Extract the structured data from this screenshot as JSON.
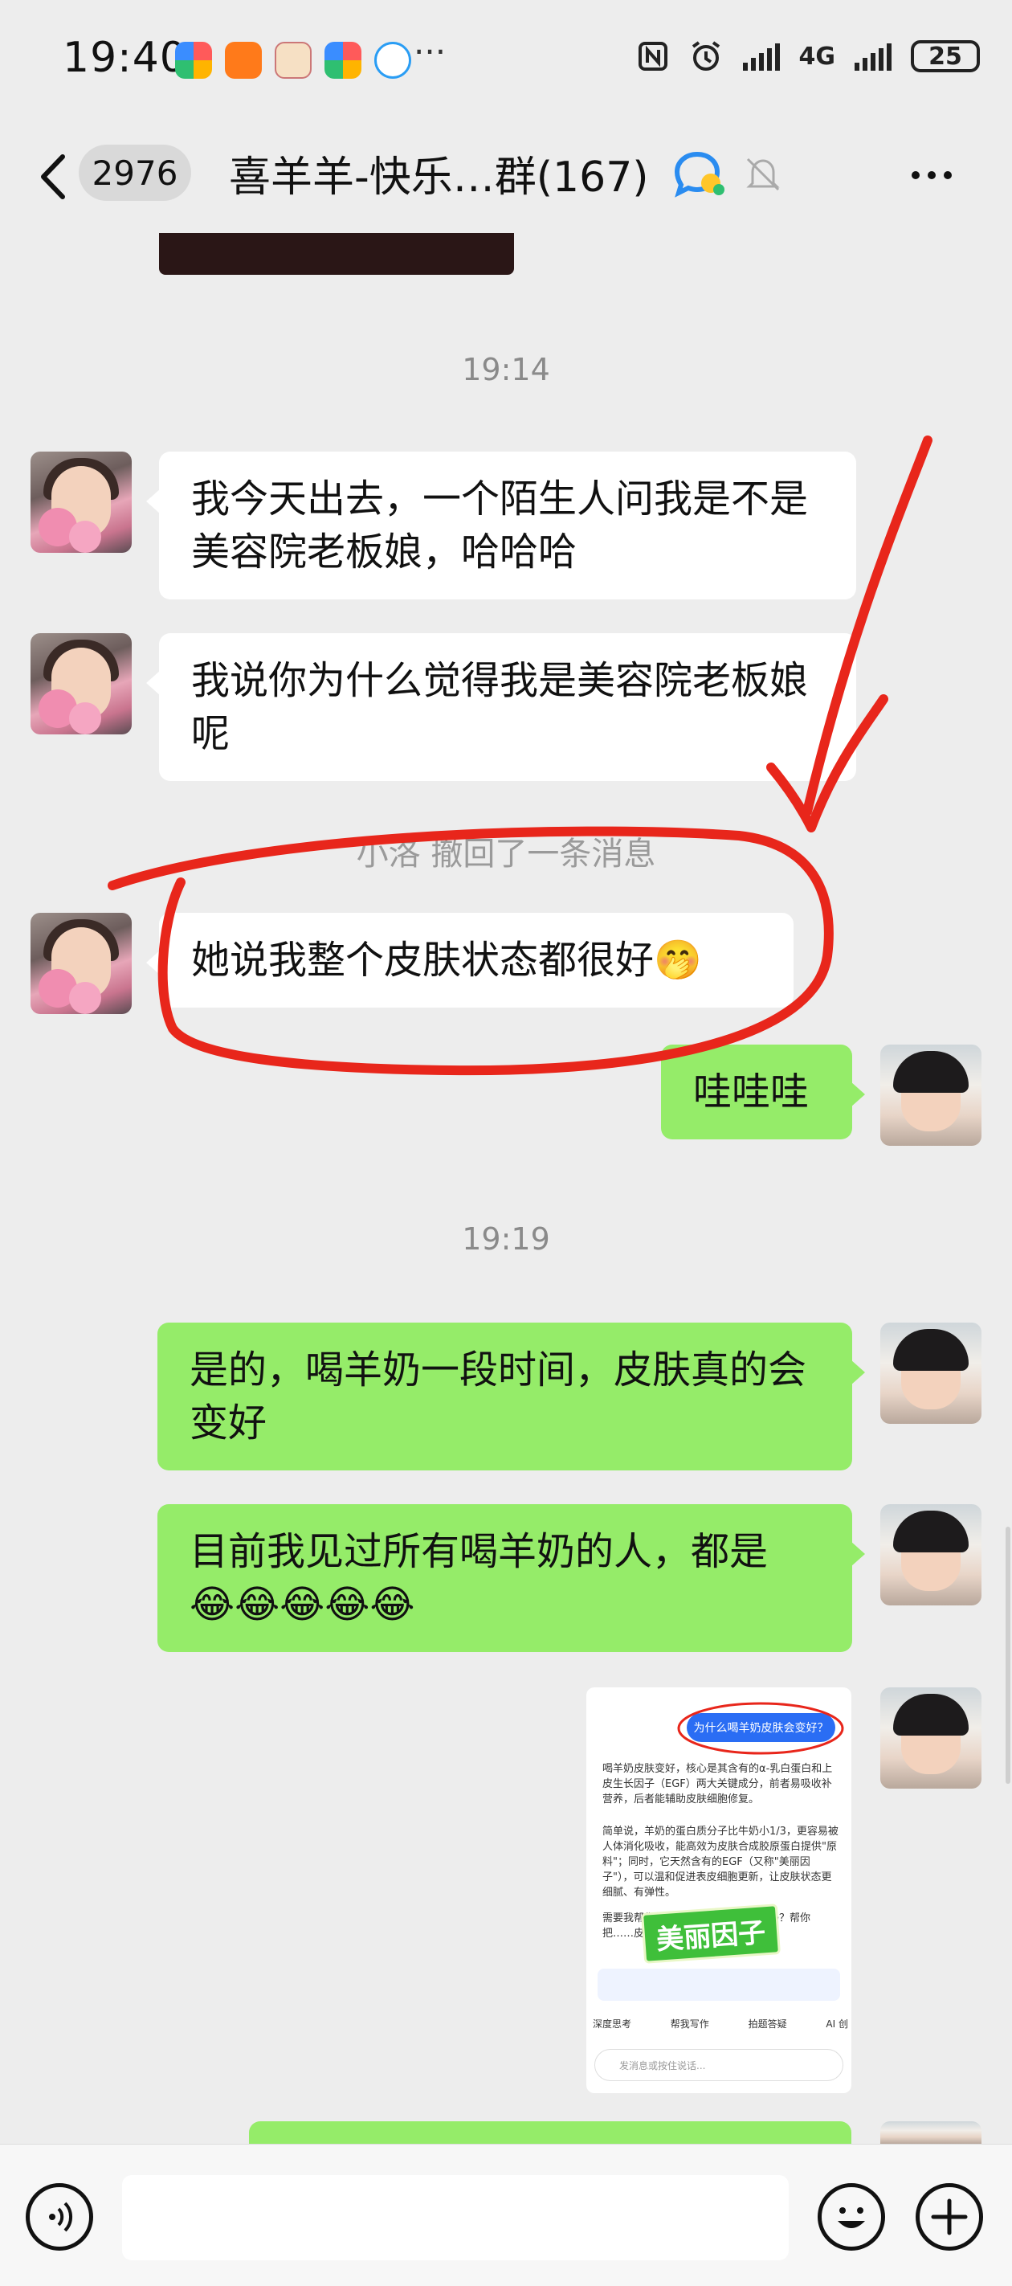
{
  "status_bar": {
    "time": "19:40",
    "more": "···",
    "network": "4G",
    "battery": "25"
  },
  "nav": {
    "unread_count": "2976",
    "title": "喜羊羊-快乐…群(167)"
  },
  "colors": {
    "background": "#ededed",
    "bubble_sent": "#95ec69",
    "bubble_received": "#ffffff",
    "annotation_red": "#e8261b"
  },
  "messages": {
    "ts1": "19:14",
    "m1": "我今天出去，一个陌生人问我是不是美容院老板娘，哈哈哈",
    "m2": "我说你为什么觉得我是美容院老板娘呢",
    "recall": "小洛 撤回了一条消息",
    "m3": "她说我整个皮肤状态都很好🤭",
    "m4": "哇哇哇",
    "ts2": "19:19",
    "m5": "是的，喝羊奶一段时间，皮肤真的会变好",
    "m6_line1": "目前我见过所有喝羊奶的人，都是",
    "m6_line2": "😂😂😂😂😂"
  },
  "shared_image": {
    "question": "为什么喝羊奶皮肤会变好？",
    "p1": "喝羊奶皮肤变好，核心是其含有的α-乳白蛋白和上皮生长因子（EGF）两大关键成分，前者易吸收补营养，后者能辅助皮肤细胞修复。",
    "p2": "简单说，羊奶的蛋白质分子比牛奶小1/3，更容易被人体消化吸收，能高效为皮肤合成胶原蛋白提供\"原料\"；同时，它天然含有的EGF（又称\"美丽因子\"），可以温和促进表皮细胞更新，让皮肤状态更细腻、有弹性。",
    "p3": "需要我帮你整理一份\"羊奶喝法\"清单吗？帮你把……皮肤状态的组合……",
    "sticker": "美丽因子",
    "chip1": "深度思考",
    "chip2": "帮我写作",
    "chip3": "拍题答疑",
    "chip4": "AI 创",
    "input_placeholder": "发消息或按住说话..."
  }
}
